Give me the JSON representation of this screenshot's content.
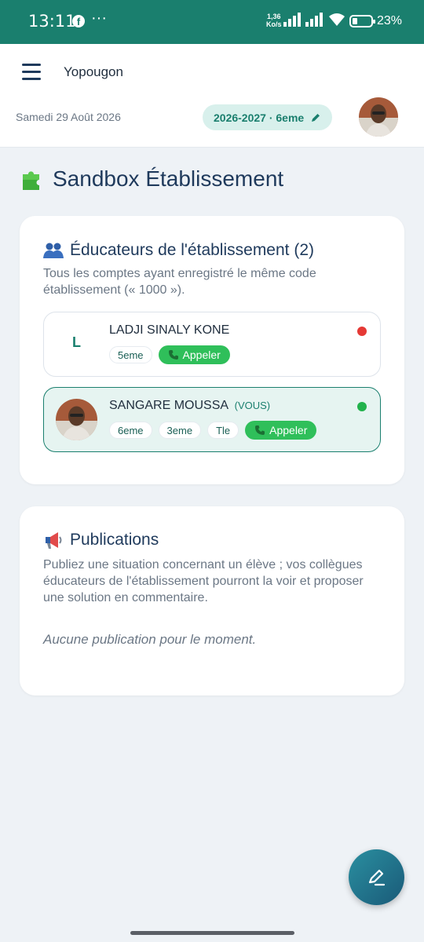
{
  "status_bar": {
    "time": "13:11",
    "more": "···",
    "speed_value": "1,36",
    "speed_unit": "Ko/s",
    "battery": "23%"
  },
  "header": {
    "city": "Yopougon",
    "date": "Samedi 29 Août 2026",
    "year_class": "2026-2027 · 6eme",
    "edit_icon": "pencil-icon"
  },
  "page": {
    "title": "Sandbox Établissement",
    "title_icon": "puzzle-icon"
  },
  "educators": {
    "title": "Éducateurs de l'établissement (2)",
    "icon": "people-icon",
    "description": "Tous les comptes ayant enregistré le même code établissement (« 1000 »).",
    "members": [
      {
        "initial": "L",
        "name": "LADJI SINALY KONE",
        "tag": "",
        "classes": [
          "5eme"
        ],
        "call_label": "Appeler",
        "status_color": "#e53935"
      },
      {
        "initial": "",
        "name": "SANGARE MOUSSA",
        "tag": "(VOUS)",
        "classes": [
          "6eme",
          "3eme",
          "Tle"
        ],
        "call_label": "Appeler",
        "status_color": "#22b24c"
      }
    ]
  },
  "publications": {
    "title": "Publications",
    "icon": "megaphone-icon",
    "description": "Publiez une situation concernant un élève ; vos collègues éducateurs de l'établissement pourront la voir et proposer une solution en commentaire.",
    "empty": "Aucune publication pour le moment."
  },
  "colors": {
    "accent": "#1a7f6e",
    "call": "#2fbf5a",
    "title": "#1f3a5c"
  }
}
